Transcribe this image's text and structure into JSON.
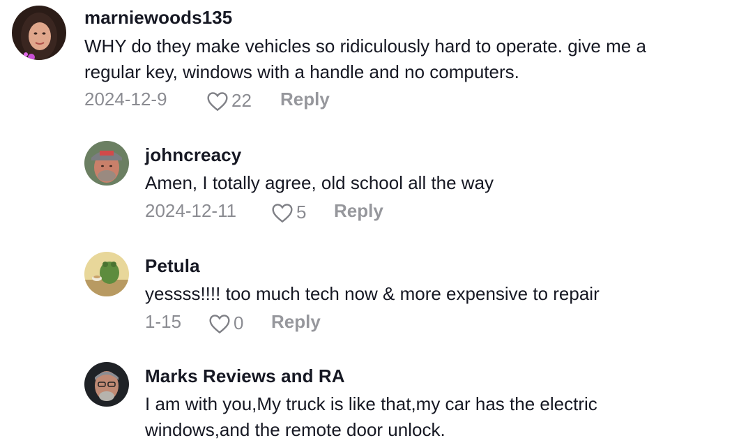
{
  "comments": [
    {
      "username": "marniewoods135",
      "text_lines": [
        "WHY do they make vehicles so ridiculously hard to operate. give me a",
        "regular key, windows with a handle and no computers."
      ],
      "date": "2024-12-9",
      "likes": "22",
      "reply_label": "Reply",
      "avatar_icon": "avatar-woman-photo"
    },
    {
      "username": "johncreacy",
      "text_lines": [
        "Amen, I totally agree, old school all the way"
      ],
      "date": "2024-12-11",
      "likes": "5",
      "reply_label": "Reply",
      "avatar_icon": "avatar-man-cap-photo"
    },
    {
      "username": "Petula",
      "text_lines": [
        "yessss!!!! too much tech now & more expensive to repair"
      ],
      "date": "1-15",
      "likes": "0",
      "reply_label": "Reply",
      "avatar_icon": "avatar-frog-illustration"
    },
    {
      "username": "Marks Reviews and RA",
      "text_lines": [
        "I am with you,My truck is like that,my car has the electric",
        "windows,and the remote door unlock."
      ],
      "avatar_icon": "avatar-man-glasses-photo"
    }
  ],
  "colors": {
    "text_primary": "#161823",
    "text_muted": "#8a8b91",
    "background": "#ffffff"
  }
}
